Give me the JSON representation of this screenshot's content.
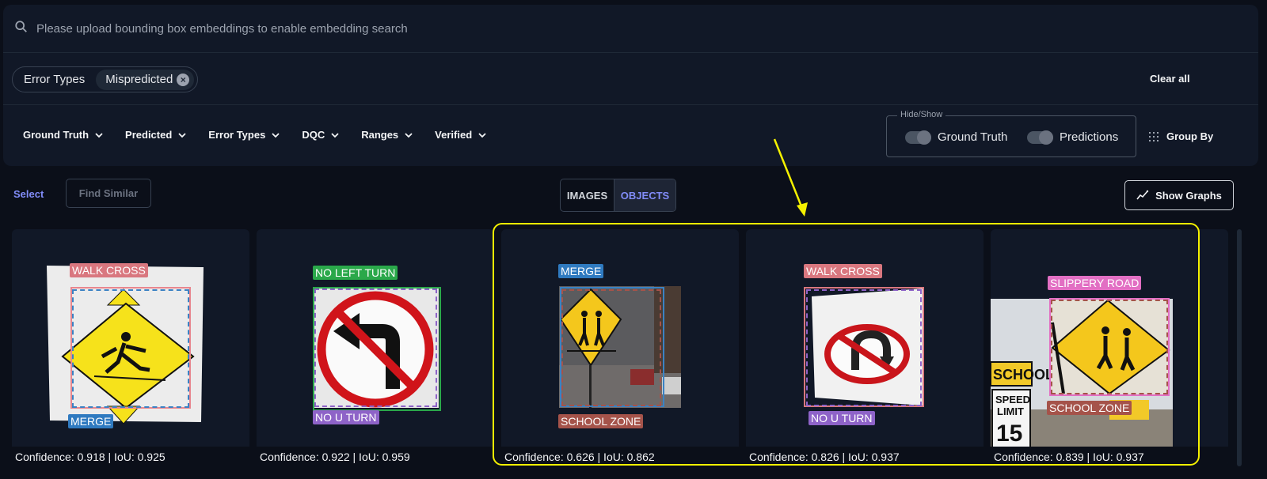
{
  "search": {
    "placeholder": "Please upload bounding box embeddings to enable embedding search"
  },
  "active_filter": {
    "label": "Error Types",
    "chip": "Mispredicted"
  },
  "clear_all": "Clear all",
  "filters": [
    "Ground Truth",
    "Predicted",
    "Error Types",
    "DQC",
    "Ranges",
    "Verified"
  ],
  "hide_show": {
    "legend": "Hide/Show",
    "ground_truth": "Ground Truth",
    "predictions": "Predictions"
  },
  "group_by": "Group By",
  "toolbar": {
    "select": "Select",
    "find_similar": "Find Similar",
    "show_graphs": "Show Graphs"
  },
  "view_toggle": {
    "images": "IMAGES",
    "objects": "OBJECTS",
    "active": "OBJECTS"
  },
  "colors": {
    "accent": "#818cf8",
    "highlight": "#f5f100",
    "background": "#0b0f19",
    "panel": "#111827"
  },
  "cards": [
    {
      "top_label": "WALK CROSS",
      "bottom_label": "MERGE",
      "footer": "Confidence: 0.918 | IoU: 0.925"
    },
    {
      "top_label": "NO LEFT TURN",
      "bottom_label": "NO U TURN",
      "footer": "Confidence: 0.922 | IoU: 0.959"
    },
    {
      "top_label": "MERGE",
      "bottom_label": "SCHOOL ZONE",
      "footer": "Confidence: 0.626 | IoU: 0.862"
    },
    {
      "top_label": "WALK CROSS",
      "bottom_label": "NO U TURN",
      "footer": "Confidence: 0.826 | IoU: 0.937"
    },
    {
      "top_label": "SLIPPERY ROAD",
      "bottom_label": "SCHOOL ZONE",
      "footer": "Confidence: 0.839 | IoU: 0.937"
    }
  ],
  "sign_texts": {
    "school": "SCHOOL",
    "speed": "SPEED",
    "limit": "LIMIT",
    "limit_value": "15"
  }
}
